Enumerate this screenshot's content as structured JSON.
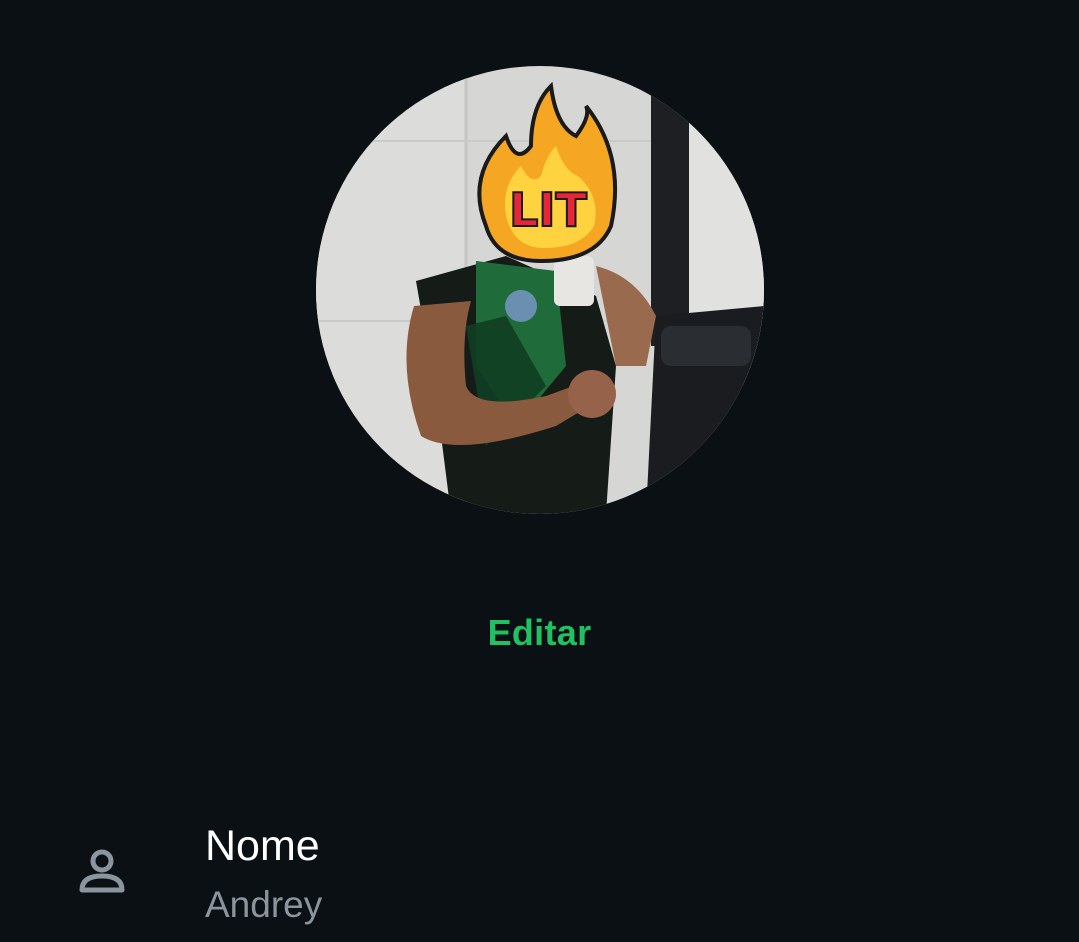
{
  "profile": {
    "edit_label": "Editar",
    "photo": {
      "sticker_text": "LIT",
      "icon": "profile-photo"
    },
    "fields": [
      {
        "icon": "person-icon",
        "title": "Nome",
        "value": "Andrey"
      }
    ]
  },
  "colors": {
    "background": "#0b1014",
    "accent": "#21c063",
    "primary_text": "#ffffff",
    "secondary_text": "#8a959e"
  }
}
